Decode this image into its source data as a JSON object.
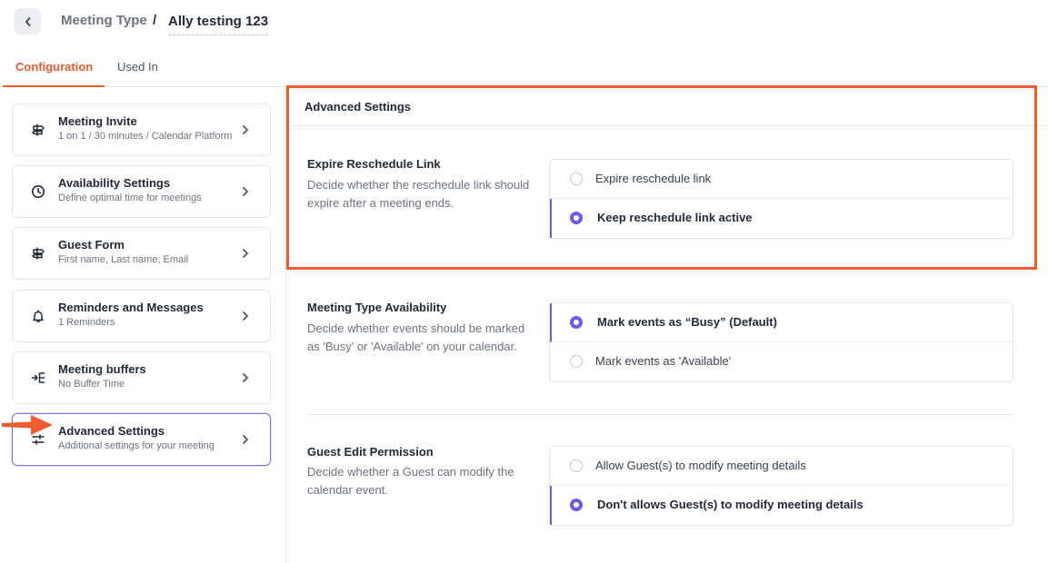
{
  "header": {
    "back_icon": "chevron-left-icon",
    "breadcrumb_parent": "Meeting Type",
    "breadcrumb_separator": "/",
    "breadcrumb_current": "Ally testing 123"
  },
  "tabs": [
    {
      "label": "Configuration",
      "active": true
    },
    {
      "label": "Used In",
      "active": false
    }
  ],
  "sidebar": {
    "items": [
      {
        "title": "Meeting Invite",
        "subtitle": "1 on 1 / 30 minutes / Calendar Platform",
        "icon": "signpost-icon"
      },
      {
        "title": "Availability Settings",
        "subtitle": "Define optimal time for meetings",
        "icon": "clock-icon"
      },
      {
        "title": "Guest Form",
        "subtitle": "First name, Last name, Email",
        "icon": "signpost-icon"
      },
      {
        "title": "Reminders and Messages",
        "subtitle": "1 Reminders",
        "icon": "bell-icon"
      },
      {
        "title": "Meeting buffers",
        "subtitle": "No Buffer Time",
        "icon": "buffer-icon"
      },
      {
        "title": "Advanced Settings",
        "subtitle": "Additional settings for your meeting",
        "icon": "sliders-icon",
        "active": true
      }
    ]
  },
  "main": {
    "section_title": "Advanced Settings",
    "settings": [
      {
        "title": "Expire Reschedule Link",
        "description": "Decide whether the reschedule link should expire after a meeting ends.",
        "options": [
          {
            "label": "Expire reschedule link",
            "selected": false
          },
          {
            "label": "Keep reschedule link active",
            "selected": true
          }
        ]
      },
      {
        "title": "Meeting Type Availability",
        "description": "Decide whether events should be marked as 'Busy' or 'Available' on your calendar.",
        "options": [
          {
            "label": "Mark events as “Busy” (Default)",
            "selected": true
          },
          {
            "label": "Mark events as 'Available'",
            "selected": false
          }
        ]
      },
      {
        "title": "Guest Edit Permission",
        "description": "Decide whether a Guest can modify the calendar event.",
        "options": [
          {
            "label": "Allow Guest(s) to modify meeting details",
            "selected": false
          },
          {
            "label": "Don't allows Guest(s) to modify meeting details",
            "selected": true
          }
        ]
      }
    ]
  },
  "colors": {
    "accent_orange": "#ea5a2d",
    "accent_purple": "#6d5ce8",
    "annotation_orange": "#ee5d2f"
  }
}
